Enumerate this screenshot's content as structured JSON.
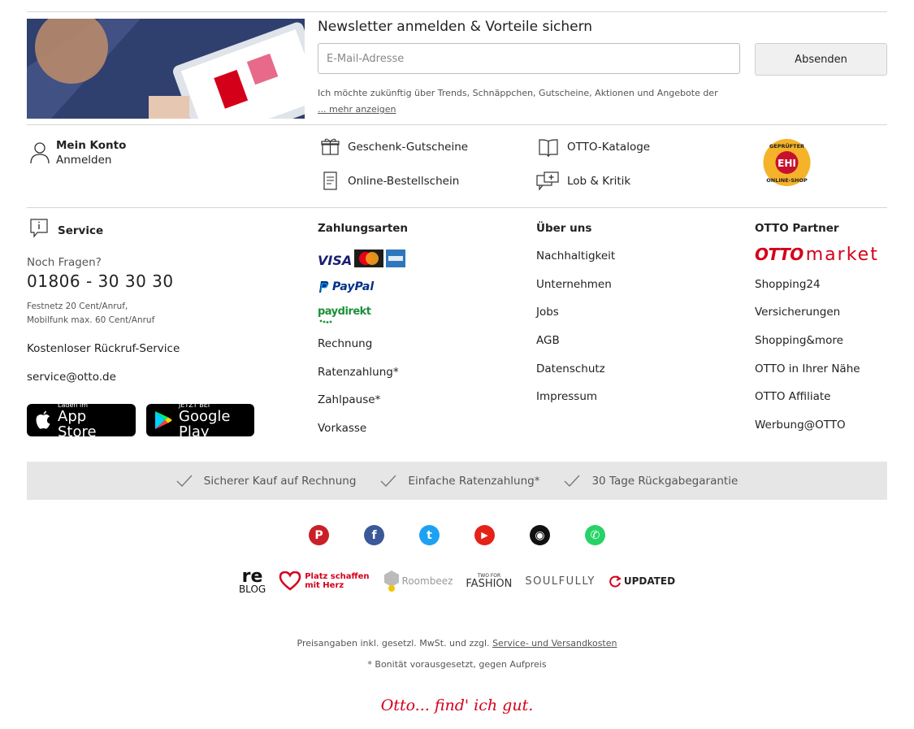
{
  "newsletter": {
    "title": "Newsletter anmelden & Vorteile sichern",
    "email_placeholder": "E-Mail-Adresse",
    "submit_label": "Absenden",
    "legal_text": "Ich möchte zukünftig über Trends, Schnäppchen, Gutscheine, Aktionen und Angebote der",
    "more_link": "... mehr anzeigen"
  },
  "account": {
    "title": "Mein Konto",
    "login": "Anmelden"
  },
  "quicklinks": {
    "gift": "Geschenk-Gutscheine",
    "order_form": "Online-Bestellschein",
    "catalogs": "OTTO-Kataloge",
    "feedback": "Lob & Kritik"
  },
  "ehi_badge": {
    "top": "GEPRÜFTER",
    "center": "EHI",
    "bottom": "ONLINE-SHOP"
  },
  "service": {
    "title": "Service",
    "question": "Noch Fragen?",
    "phone": "01806 - 30 30 30",
    "fee_line1": "Festnetz 20 Cent/Anruf,",
    "fee_line2": "Mobilfunk max. 60 Cent/Anruf",
    "callback": "Kostenloser Rückruf-Service",
    "email": "service@otto.de",
    "appstore_small": "Laden im",
    "appstore_big": "App Store",
    "googleplay_small": "JETZT BEI",
    "googleplay_big": "Google Play"
  },
  "payment": {
    "title": "Zahlungsarten",
    "visa": "VISA",
    "paypal": "PayPal",
    "paydirekt": "paydirekt",
    "links": [
      "Rechnung",
      "Ratenzahlung*",
      "Zahlpause*",
      "Vorkasse"
    ]
  },
  "about": {
    "title": "Über uns",
    "links": [
      "Nachhaltigkeit",
      "Unternehmen",
      "Jobs",
      "AGB",
      "Datenschutz",
      "Impressum"
    ]
  },
  "partner": {
    "title": "OTTO Partner",
    "otto_logo": "OTTO",
    "market_logo": "market",
    "links": [
      "Shopping24",
      "Versicherungen",
      "Shopping&more",
      "OTTO in Ihrer Nähe",
      "OTTO Affiliate",
      "Werbung@OTTO"
    ]
  },
  "trust": {
    "items": [
      "Sicherer Kauf auf Rechnung",
      "Einfache Ratenzahlung*",
      "30 Tage Rückgabegarantie"
    ]
  },
  "social": {
    "pinterest": "P",
    "facebook": "f",
    "twitter": "t",
    "youtube": "▶",
    "instagram": "◉",
    "whatsapp": "✆"
  },
  "brands": {
    "reblog_top": "re",
    "reblog_bottom": "BLOG",
    "platz_line1": "Platz schaffen",
    "platz_line2": "mit Herz",
    "roombeez": "Roombeez",
    "twoforfashion_top": "TWO FOR",
    "twoforfashion_bottom": "FASHION",
    "soulfully": "SOULFULLY",
    "updated": "UPDATED"
  },
  "footer": {
    "price_note": "Preisangaben inkl. gesetzl. MwSt. und zzgl.",
    "shipping_link": "Service- und Versandkosten",
    "credit_note": "* Bonität vorausgesetzt, gegen Aufpreis",
    "slogan": "Otto... find' ich gut."
  },
  "colors": {
    "otto_red": "#d4001a",
    "divider": "#d6d6d6",
    "trust_bg": "#e6e6e6"
  }
}
